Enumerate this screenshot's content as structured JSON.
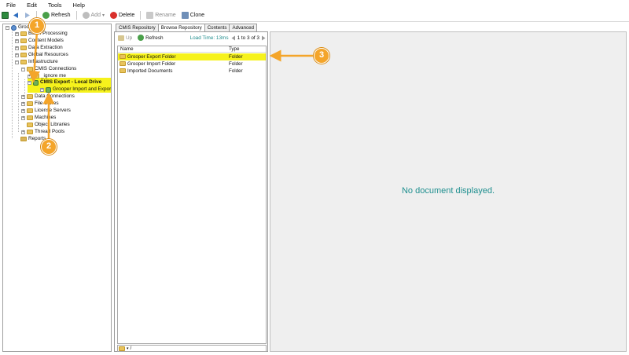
{
  "menu": {
    "file": "File",
    "edit": "Edit",
    "tools": "Tools",
    "help": "Help"
  },
  "toolbar": {
    "refresh": "Refresh",
    "add": "Add",
    "add_arrow": "▾",
    "delete": "Delete",
    "rename": "Rename",
    "clone": "Clone"
  },
  "tree": {
    "root": "Groo",
    "items": [
      {
        "label": "Batch Processing"
      },
      {
        "label": "Content Models"
      },
      {
        "label": "Data Extraction"
      },
      {
        "label": "Global Resources"
      },
      {
        "label": "Infrastructure"
      },
      {
        "label": "CMIS Connections"
      },
      {
        "label": "_ignore me"
      },
      {
        "label": "CMIS Export - Local Drive"
      },
      {
        "label": "Grooper Import and Export"
      },
      {
        "label": "Data Connections"
      },
      {
        "label": "File Stores"
      },
      {
        "label": "License Servers"
      },
      {
        "label": "Machines"
      },
      {
        "label": "Object Libraries"
      },
      {
        "label": "Thread Pools"
      },
      {
        "label": "Reports"
      }
    ]
  },
  "tabs": [
    "CMIS Repository",
    "Browse Repository",
    "Contents",
    "Advanced"
  ],
  "browse": {
    "up": "Up",
    "refresh": "Refresh",
    "load_time": "Load Time: 13ms",
    "pager": "1 to 3 of 3",
    "columns": {
      "name": "Name",
      "type": "Type"
    },
    "rows": [
      {
        "name": "Grooper Export Folder",
        "type": "Folder"
      },
      {
        "name": "Grooper Import Folder",
        "type": "Folder"
      },
      {
        "name": "Imported Documents",
        "type": "Folder"
      }
    ],
    "path_arrow": "▾",
    "path": "/"
  },
  "viewer": {
    "message": "No document displayed."
  },
  "callouts": {
    "one": "1",
    "two": "2",
    "three": "3"
  },
  "colors": {
    "highlight": "#f6f21c",
    "callout": "#f4a52a",
    "accent": "#1f8f8f"
  }
}
